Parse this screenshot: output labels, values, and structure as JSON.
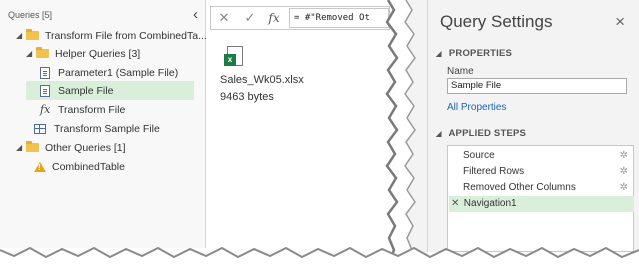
{
  "queries_pane": {
    "title": "Queries [5]",
    "collapse_chevron": "‹",
    "items": [
      {
        "label": "Transform File from CombinedTa...",
        "icon": "folder-icon",
        "expanded": true
      },
      {
        "label": "Helper Queries [3]",
        "icon": "folder-icon",
        "expanded": true
      },
      {
        "label": "Parameter1 (Sample File)",
        "icon": "parameter-icon"
      },
      {
        "label": "Sample File",
        "icon": "table-doc-icon",
        "selected": true
      },
      {
        "label": "Transform File",
        "icon": "function-icon"
      },
      {
        "label": "Transform Sample File",
        "icon": "table-icon"
      },
      {
        "label": "Other Queries [1]",
        "icon": "folder-icon",
        "expanded": true
      },
      {
        "label": "CombinedTable",
        "icon": "warning-icon"
      }
    ]
  },
  "formula_bar": {
    "cancel": "✕",
    "confirm": "✓",
    "fx": "fx",
    "formula": "= #\"Removed Ot"
  },
  "file": {
    "name": "Sales_Wk05.xlsx",
    "size": "9463 bytes",
    "badge": "x"
  },
  "settings": {
    "title": "Query Settings",
    "close": "×",
    "properties_header": "PROPERTIES",
    "name_label": "Name",
    "name_value": "Sample File",
    "all_properties": "All Properties",
    "applied_steps_header": "APPLIED STEPS",
    "steps": [
      {
        "label": "Source",
        "has_gear": true
      },
      {
        "label": "Filtered Rows",
        "has_gear": true
      },
      {
        "label": "Removed Other Columns",
        "has_gear": true
      },
      {
        "label": "Navigation1",
        "has_gear": false,
        "selected": true
      }
    ]
  },
  "colors": {
    "selection": "#d9efd9",
    "link": "#1a64b4",
    "folder": "#f2c14e",
    "excel_green": "#1d7a44",
    "warning": "#e6a21a"
  }
}
